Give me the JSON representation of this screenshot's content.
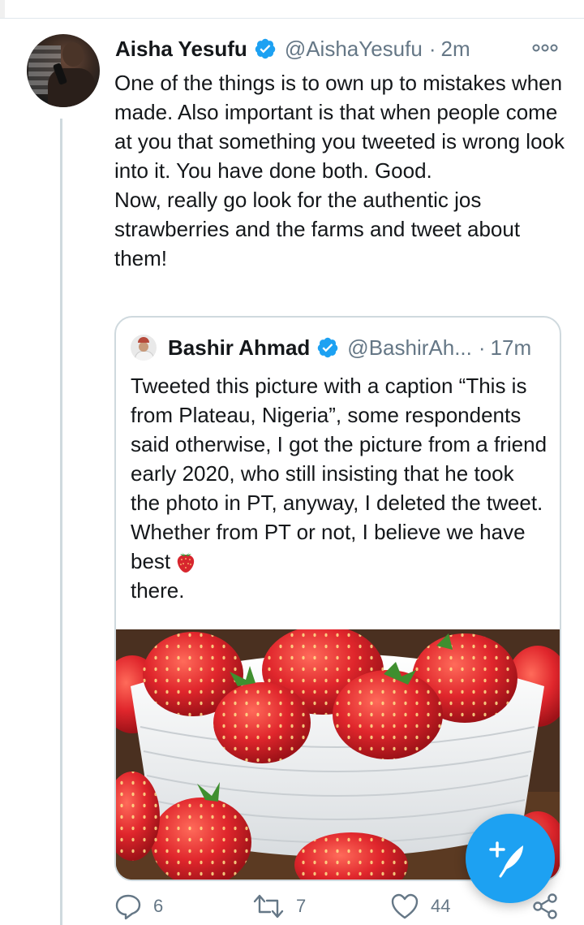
{
  "tweet": {
    "author_name": "Aisha Yesufu",
    "author_handle": "@AishaYesufu",
    "separator": "·",
    "time": "2m",
    "text_lines": [
      "One of the things is to own up to mistakes when made. Also important is that when people come at you that something you tweeted is wrong look into it. You have done both. Good.",
      "Now, really go look for the authentic jos strawberries and the farms and tweet about them!"
    ]
  },
  "quote": {
    "author_name": "Bashir Ahmad",
    "author_handle": "@BashirAh...",
    "separator": "·",
    "time": "17m",
    "text": "Tweeted this picture with a caption “This is from Plateau, Nigeria”, some respondents said otherwise, I got the picture from a friend early 2020, who still insisting that he took the photo in PT, anyway, I deleted the tweet. Whether from PT or not, I believe we have best",
    "text_after_emoji": "there.",
    "emoji": "strawberry-emoji"
  },
  "actions": {
    "reply_count": "6",
    "retweet_count": "7",
    "like_count": "44"
  },
  "colors": {
    "accent": "#1da1f2",
    "muted_text": "#657786",
    "border": "#cfd9de",
    "strawberry": "#d7262e"
  }
}
